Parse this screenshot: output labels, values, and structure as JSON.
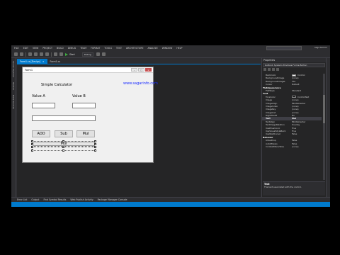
{
  "menu": [
    "FILE",
    "EDIT",
    "VIEW",
    "PROJECT",
    "BUILD",
    "DEBUG",
    "TEAM",
    "FORMAT",
    "TOOLS",
    "TEST",
    "ARCHITECTURE",
    "ANALYZE",
    "WINDOW",
    "HELP"
  ],
  "toolbar": {
    "start_label": "Start",
    "config": "Debug"
  },
  "user_label": "saga tamrin",
  "left_rail": [
    "Server Explorer",
    "Toolbox",
    "Data Sources"
  ],
  "doc_tabs": [
    {
      "label": "Form1.cs [Design]",
      "active": true
    },
    {
      "label": "Form1.cs",
      "active": false
    }
  ],
  "form": {
    "title": "Form1",
    "heading": "Simple Calculator",
    "value_a_label": "Value A",
    "value_b_label": "Value B",
    "buttons": [
      "ADD",
      "Sub",
      "Mul"
    ],
    "selected_button": "Mul",
    "window_controls": [
      "–",
      "□",
      "×"
    ]
  },
  "watermark": "www.sagarinfo.com",
  "properties": {
    "title": "Properties",
    "object": "button1  System.Windows.Forms.Button",
    "rows": [
      {
        "name": "BackColor",
        "value": "Control",
        "swatch": "#f0f0f0"
      },
      {
        "name": "BackgroundImage",
        "value": "(none)"
      },
      {
        "name": "BackgroundImageL",
        "value": "Tile"
      },
      {
        "name": "Cursor",
        "value": "Default"
      },
      {
        "name": "FlatAppearance",
        "value": "",
        "category": true
      },
      {
        "name": "FlatStyle",
        "value": "Standard"
      },
      {
        "name": "Font",
        "value": "Microsoft Sans Serif",
        "category": true
      },
      {
        "name": "ForeColor",
        "value": "ControlText",
        "swatch": "#000000"
      },
      {
        "name": "Image",
        "value": "(none)"
      },
      {
        "name": "ImageAlign",
        "value": "MiddleCenter"
      },
      {
        "name": "ImageIndex",
        "value": "(none)"
      },
      {
        "name": "ImageKey",
        "value": "(none)"
      },
      {
        "name": "ImageList",
        "value": "(none)"
      },
      {
        "name": "RightToLeft",
        "value": "No"
      },
      {
        "name": "Text",
        "value": "Mul",
        "selected": true
      },
      {
        "name": "TextAlign",
        "value": "MiddleCenter"
      },
      {
        "name": "TextImageRelation",
        "value": "Overlay"
      },
      {
        "name": "UseMnemonic",
        "value": "True"
      },
      {
        "name": "UseVisualStyleBack",
        "value": "True"
      },
      {
        "name": "UseWaitCursor",
        "value": "False"
      },
      {
        "name": "Behavior",
        "value": "",
        "category": true
      },
      {
        "name": "AllowDrop",
        "value": "False"
      },
      {
        "name": "AutoEllipsis",
        "value": "False"
      },
      {
        "name": "ContextMenuStrip",
        "value": "(none)"
      }
    ],
    "desc_title": "Text",
    "desc_text": "The text associated with the control."
  },
  "bottom_tabs": [
    "Error List",
    "Output",
    "Find Symbol Results",
    "Web Publish Activity",
    "Package Manager Console"
  ],
  "colors": {
    "accent": "#007acc",
    "ide_bg": "#2d2d30",
    "form_bg": "#f0f0f0",
    "watermark": "#1a2cff"
  }
}
